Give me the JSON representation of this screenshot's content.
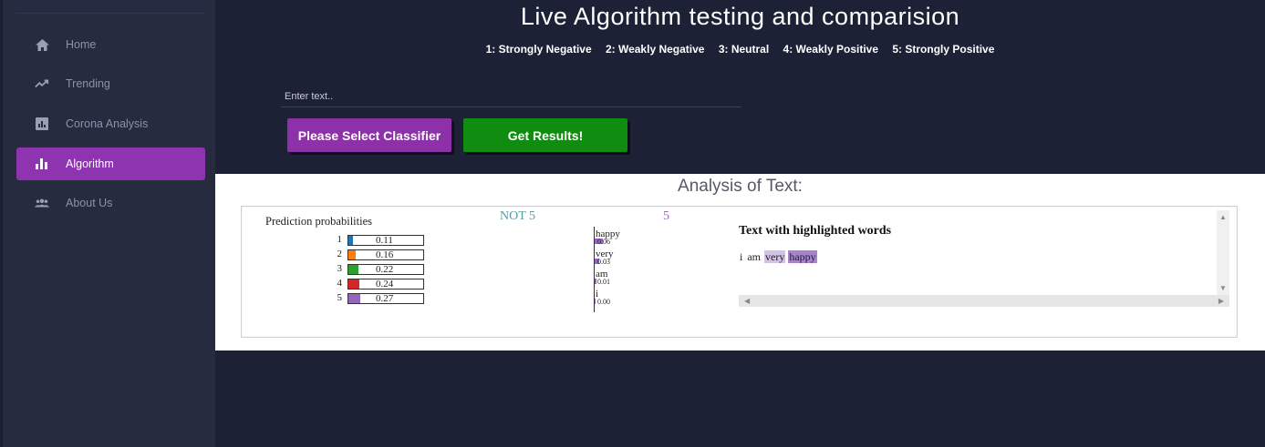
{
  "sidebar": {
    "items": [
      {
        "label": "Home",
        "icon": "home-icon"
      },
      {
        "label": "Trending",
        "icon": "trending-icon"
      },
      {
        "label": "Corona Analysis",
        "icon": "chart-box-icon"
      },
      {
        "label": "Algorithm",
        "icon": "bar-chart-icon",
        "active": true
      },
      {
        "label": "About Us",
        "icon": "group-icon"
      }
    ]
  },
  "header": {
    "title": "Live Algorithm testing and comparision",
    "legend": [
      "1: Strongly Negative",
      "2: Weakly Negative",
      "3: Neutral",
      "4: Weakly Positive",
      "5: Strongly Positive"
    ]
  },
  "form": {
    "input_placeholder": "Enter text..",
    "classifier_button": "Please Select Classifier",
    "results_button": "Get Results!"
  },
  "analysis": {
    "title": "Analysis of Text:",
    "prediction_title": "Prediction probabilities",
    "probabilities": [
      {
        "class": "1",
        "value": "0.11",
        "fraction": 0.11,
        "color": "#1f77b4"
      },
      {
        "class": "2",
        "value": "0.16",
        "fraction": 0.16,
        "color": "#ff7f0e"
      },
      {
        "class": "3",
        "value": "0.22",
        "fraction": 0.22,
        "color": "#2ca02c"
      },
      {
        "class": "4",
        "value": "0.24",
        "fraction": 0.24,
        "color": "#d62728"
      },
      {
        "class": "5",
        "value": "0.27",
        "fraction": 0.27,
        "color": "#9467bd"
      }
    ],
    "not_label": "NOT 5",
    "pos_label": "5",
    "features": [
      {
        "word": "happy",
        "weight": "0.06",
        "fraction": 0.06
      },
      {
        "word": "very",
        "weight": "0.03",
        "fraction": 0.03
      },
      {
        "word": "am",
        "weight": "0.01",
        "fraction": 0.01
      },
      {
        "word": "i",
        "weight": "0.00",
        "fraction": 0.0
      }
    ],
    "highlight_title": "Text with highlighted words",
    "highlight_words": [
      {
        "text": "i",
        "bg": "transparent"
      },
      {
        "text": "am",
        "bg": "transparent"
      },
      {
        "text": "very",
        "bg": "#d3c2e6"
      },
      {
        "text": "happy",
        "bg": "#a884d0"
      }
    ]
  }
}
